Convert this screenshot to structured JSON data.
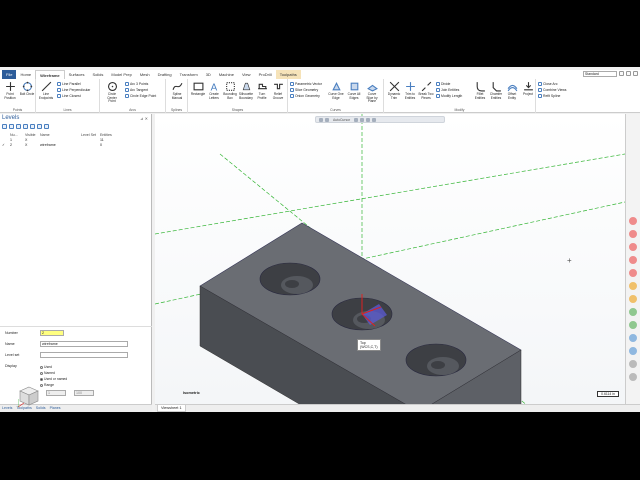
{
  "tabs": [
    "File",
    "Home",
    "Wireframe",
    "Surfaces",
    "Solids",
    "Model Prep",
    "Mesh",
    "Drafting",
    "Transform",
    "3D",
    "Machine",
    "View",
    "ProDrill",
    "Toolpaths"
  ],
  "active_tab": "Wireframe",
  "standard_select": "Standard",
  "ribbon": {
    "points": {
      "label": "Points",
      "buttons": [
        "Point Position",
        "Bolt Circle"
      ]
    },
    "lines": {
      "label": "Lines",
      "big": "Line Endpoints",
      "small": [
        "Line Parallel",
        "Line Perpendicular",
        "Line Closest"
      ]
    },
    "arcs": {
      "label": "Arcs",
      "big": "Circle Center Point",
      "small": [
        "Arc 3 Points",
        "Arc Tangent",
        "Circle Edge Point"
      ]
    },
    "splines": {
      "label": "Splines",
      "buttons": [
        "Spline Manual"
      ]
    },
    "shapes": {
      "label": "Shapes",
      "buttons": [
        "Rectangle",
        "Create Letters",
        "Bounding Box",
        "Silhouette Boundary",
        "Turn Profile",
        "Relief Groove"
      ]
    },
    "curves": {
      "label": "Curves",
      "buttons": [
        "Curve One Edge",
        "Curve All Edges",
        "Curve Slice by Plane"
      ],
      "small": [
        "Parametric Vector",
        "Slice Geometry",
        "Onion Geometry"
      ]
    },
    "modify": {
      "label": "Modify",
      "buttons": [
        "Dynamic Trim",
        "Trim to Entities",
        "Break Two Pieces",
        "Fillet Entities",
        "Chamfer Entities",
        "Offset Entity",
        "Project"
      ],
      "small": [
        "Divide",
        "Join Entities",
        "Modify Length"
      ]
    },
    "misc_small": [
      "Close Arc",
      "Combine Views",
      "Refit Spline"
    ]
  },
  "levels": {
    "title": "Levels",
    "columns": [
      "Nu...",
      "Visible",
      "Name",
      "Level Set",
      "Entities"
    ],
    "rows": [
      {
        "num": "1",
        "visible": "X",
        "name": "",
        "set": "",
        "entities": "11"
      },
      {
        "num": "2",
        "visible": "X",
        "name": "wireframe",
        "set": "",
        "entities": "0"
      }
    ],
    "props": {
      "number_label": "Number",
      "number": "2",
      "name_label": "Name",
      "name": "wireframe",
      "level_set_label": "Level set",
      "level_set": "",
      "display_label": "Display",
      "options": [
        "Used",
        "Named",
        "Used or named",
        "Range"
      ],
      "range_from": "1",
      "range_to": "100"
    },
    "panel_tabs": [
      "Levels",
      "Toolpaths",
      "Solids",
      "Planes"
    ]
  },
  "viewport": {
    "qat_label": "AutoCursor",
    "view_name": "Isometric",
    "scale": "0.6114 in",
    "origin_tag_line1": "Top",
    "origin_tag_line2": "(WCS,C,T)"
  },
  "viewsheet": "Viewsheet 1",
  "colors": {
    "file_tab": "#2c5c9a",
    "solid_face": "#5a5d62",
    "wire_green": "#35b535",
    "accent_blue": "#2c5c9a"
  }
}
